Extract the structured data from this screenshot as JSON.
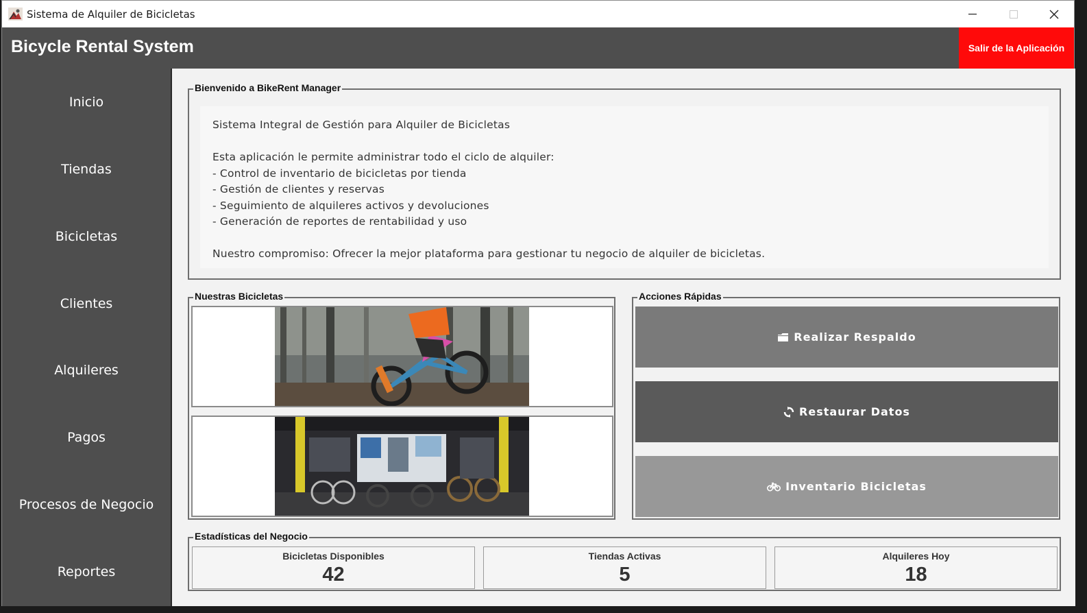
{
  "window": {
    "title": "Sistema de Alquiler de Bicicletas"
  },
  "header": {
    "title": "Bicycle Rental System",
    "exit_label": "Salir de la Aplicación",
    "exit_color": "#ff0a0a"
  },
  "sidebar": {
    "items": [
      {
        "label": "Inicio"
      },
      {
        "label": "Tiendas"
      },
      {
        "label": "Bicicletas"
      },
      {
        "label": "Clientes"
      },
      {
        "label": "Alquileres"
      },
      {
        "label": "Pagos"
      },
      {
        "label": "Procesos de Negocio"
      },
      {
        "label": "Reportes"
      }
    ]
  },
  "welcome": {
    "legend": "Bienvenido a BikeRent Manager",
    "heading": "Sistema Integral de Gestión para Alquiler de Bicicletas",
    "intro": "Esta aplicación le permite administrar todo el ciclo de alquiler:",
    "bullets": [
      "- Control de inventario de bicicletas por tienda",
      "- Gestión de clientes y reservas",
      "- Seguimiento de alquileres activos y devoluciones",
      "- Generación de reportes de rentabilidad y uso"
    ],
    "commitment": "Nuestro compromiso: Ofrecer la mejor plataforma para gestionar tu negocio de alquiler de bicicletas."
  },
  "bikes": {
    "legend": "Nuestras Bicicletas",
    "images": [
      {
        "icon": "mountain-bike-jump-photo"
      },
      {
        "icon": "bike-shop-interior-photo"
      }
    ]
  },
  "actions": {
    "legend": "Acciones Rápidas",
    "buttons": [
      {
        "label": "Realizar Respaldo",
        "icon": "folder-icon",
        "color": "#7a7a7a"
      },
      {
        "label": "Restaurar Datos",
        "icon": "refresh-icon",
        "color": "#5a5a5a"
      },
      {
        "label": "Inventario Bicicletas",
        "icon": "bicycle-icon",
        "color": "#989898"
      }
    ]
  },
  "stats": {
    "legend": "Estadísticas del Negocio",
    "cards": [
      {
        "label": "Bicicletas Disponibles",
        "value": "42"
      },
      {
        "label": "Tiendas Activas",
        "value": "5"
      },
      {
        "label": "Alquileres Hoy",
        "value": "18"
      }
    ]
  }
}
